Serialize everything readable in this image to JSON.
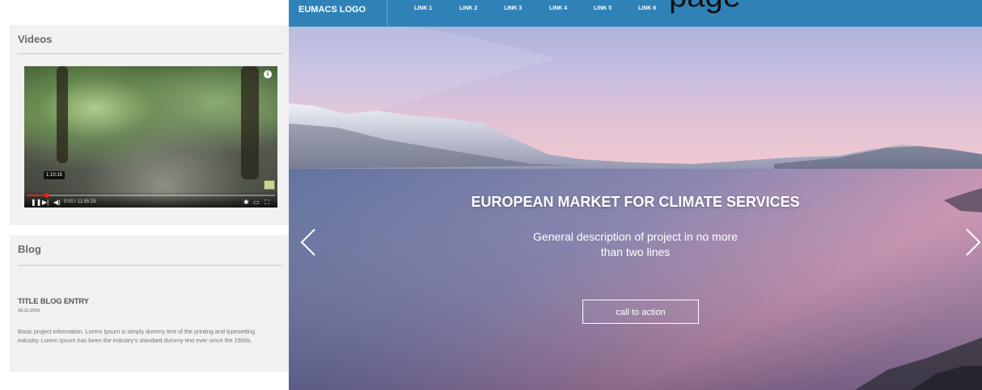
{
  "sidebar": {
    "videos": {
      "title": "Videos",
      "player": {
        "time_tooltip": "1:10:15",
        "time_display": "0:00 / 11:55:25",
        "progress": 0.08,
        "icons": [
          "info-icon",
          "pause-icon",
          "next-icon",
          "volume-icon",
          "settings-icon",
          "theater-mode-icon",
          "fullscreen-icon"
        ]
      }
    },
    "blog": {
      "title": "Blog",
      "entry": {
        "title": "TITLE BLOG ENTRY",
        "date": "18.11.2016",
        "text": "Basic project information. Lorem Ipsum is simply dummy text of the printing and typesetting industry. Lorem Ipsum has been the industry's standard dummy text ever since the 1500s."
      }
    }
  },
  "nav": {
    "logo": "EUMACS LOGO",
    "links": [
      "LINK 1",
      "LINK 2",
      "LINK 3",
      "LINK 4",
      "LINK 5",
      "LINK 6"
    ],
    "overflow_text": "page",
    "color": "#2f82b8"
  },
  "hero": {
    "headline": "EUROPEAN MARKET FOR CLIMATE SERVICES",
    "description": "General description of project  in no more than two lines",
    "cta_label": "call to action",
    "prev_icon": "chevron-left-icon",
    "next_icon": "chevron-right-icon"
  }
}
